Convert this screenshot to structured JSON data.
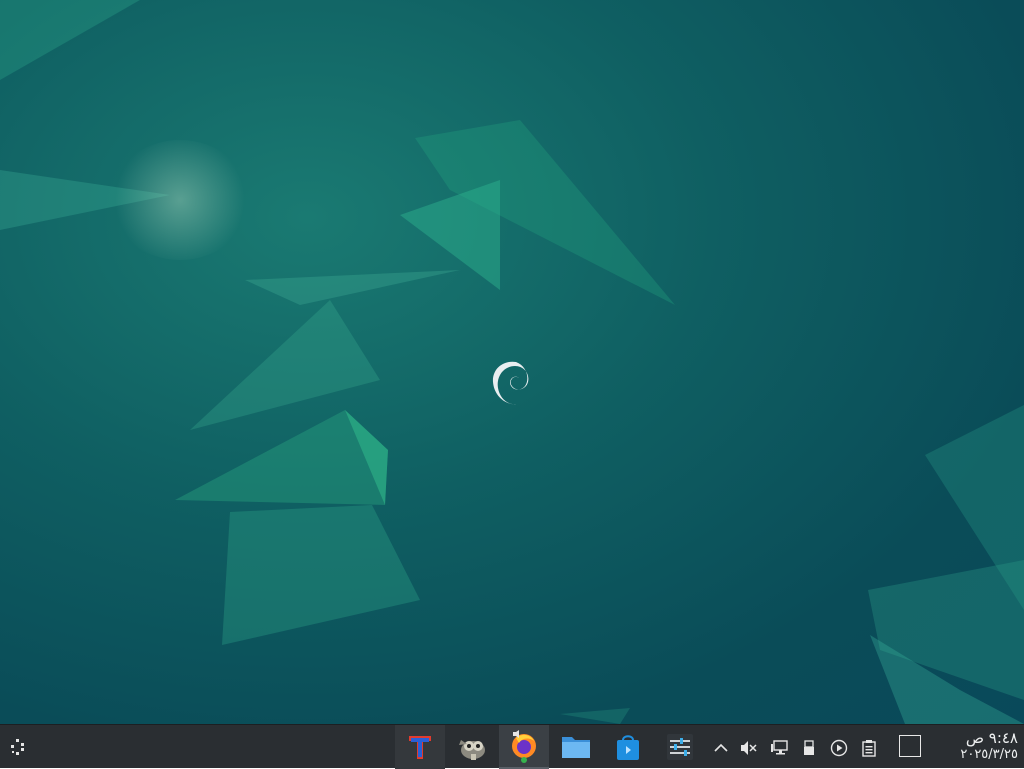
{
  "taskbar": {
    "launcher_icon": "app-launcher-icon",
    "tasks": [
      {
        "name": "typing-app",
        "icon": "t-letter-icon"
      },
      {
        "name": "gimp",
        "icon": "gimp-icon"
      },
      {
        "name": "firefox",
        "icon": "firefox-icon"
      },
      {
        "name": "file-manager",
        "icon": "folder-icon"
      },
      {
        "name": "software-store",
        "icon": "store-bag-icon"
      },
      {
        "name": "system-settings",
        "icon": "settings-sliders-icon"
      }
    ],
    "tray": [
      {
        "name": "expand-tray",
        "icon": "chevron-up-icon"
      },
      {
        "name": "volume",
        "icon": "speaker-muted-icon"
      },
      {
        "name": "network",
        "icon": "network-monitor-icon"
      },
      {
        "name": "usb-devices",
        "icon": "usb-icon"
      },
      {
        "name": "media-player",
        "icon": "play-circle-icon"
      },
      {
        "name": "clipboard",
        "icon": "clipboard-icon"
      }
    ],
    "show_desktop_icon": "show-desktop-icon"
  },
  "clock": {
    "time": "٩:٤٨ ص",
    "date": "٢٠٢٥/٣/٢٥"
  },
  "colors": {
    "taskbar_bg": "#2a2e32",
    "wallpaper_dark": "#0a4c58",
    "wallpaper_teal": "#1a8a76"
  }
}
